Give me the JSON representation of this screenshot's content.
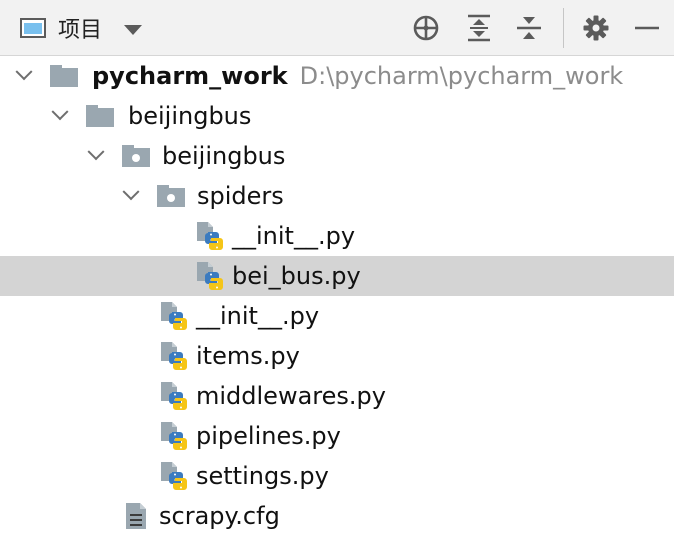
{
  "toolbar": {
    "view_label": "项目",
    "view_icon": "project-window-icon",
    "dropdown_icon": "caret-down-icon",
    "buttons": [
      {
        "name": "locate-icon"
      },
      {
        "name": "expand-all-icon"
      },
      {
        "name": "collapse-all-icon"
      },
      {
        "name": "gear-icon"
      },
      {
        "name": "minimize-icon"
      }
    ]
  },
  "tree": {
    "root": {
      "label": "pycharm_work",
      "path": "D:\\pycharm\\pycharm_work"
    },
    "items": [
      {
        "label": "beijingbus"
      },
      {
        "label": "beijingbus"
      },
      {
        "label": "spiders"
      },
      {
        "label": "__init__.py"
      },
      {
        "label": "bei_bus.py"
      },
      {
        "label": "__init__.py"
      },
      {
        "label": "items.py"
      },
      {
        "label": "middlewares.py"
      },
      {
        "label": "pipelines.py"
      },
      {
        "label": "settings.py"
      },
      {
        "label": "scrapy.cfg"
      }
    ],
    "selected": "bei_bus.py",
    "colors": {
      "selection": "#d4d4d4",
      "folder": "#9aa7b0",
      "python_blue": "#3b7bbf",
      "python_yellow": "#f5c518"
    }
  }
}
